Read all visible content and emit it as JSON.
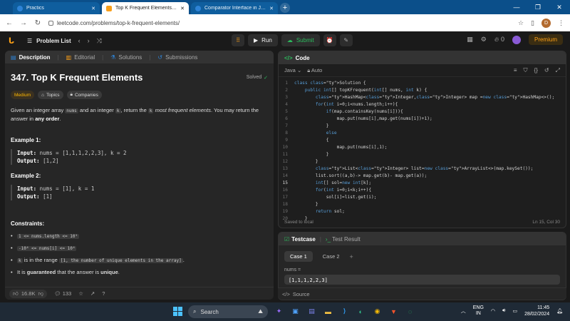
{
  "browser": {
    "tabs": [
      {
        "title": "Practics",
        "active": false
      },
      {
        "title": "Top K Frequent Elements - LeetCode",
        "active": true
      },
      {
        "title": "Comparator Interface in Java with Examples",
        "active": false
      }
    ],
    "url": "leetcode.com/problems/top-k-frequent-elements/",
    "profile_initial": "D"
  },
  "header": {
    "problem_list": "Problem List",
    "run": "Run",
    "submit": "Submit",
    "streak": "0",
    "premium": "Premium"
  },
  "left_tabs": {
    "description": "Description",
    "editorial": "Editorial",
    "solutions": "Solutions",
    "submissions": "Submissions"
  },
  "problem": {
    "title": "347. Top K Frequent Elements",
    "status": "Solved",
    "difficulty": "Medium",
    "topics": "Topics",
    "companies": "Companies",
    "desc_1": "Given an integer array ",
    "desc_code_1": "nums",
    "desc_2": " and an integer ",
    "desc_code_2": "k",
    "desc_3": ", return the ",
    "desc_code_3": "k",
    "desc_em": " most frequent elements",
    "desc_4": ". You may return the answer in ",
    "desc_bold": "any order",
    "desc_5": ".",
    "example1_title": "Example 1:",
    "example1_input_label": "Input:",
    "example1_input": " nums = [1,1,1,2,2,3], k = 2",
    "example1_output_label": "Output:",
    "example1_output": " [1,2]",
    "example2_title": "Example 2:",
    "example2_input_label": "Input:",
    "example2_input": " nums = [1], k = 1",
    "example2_output_label": "Output:",
    "example2_output": " [1]",
    "constraints_title": "Constraints:",
    "c1": "1 <= nums.length <= 10⁵",
    "c2": "-10⁴ <= nums[i] <= 10⁴",
    "c3_code": "k",
    "c3_text": " is in the range ",
    "c3_range": "[1, the number of unique elements in the array]",
    "c3_end": ".",
    "c4_a": "It is ",
    "c4_b": "guaranteed",
    "c4_c": " that the answer is ",
    "c4_d": "unique",
    "c4_e": "."
  },
  "footer": {
    "likes": "16.8K",
    "comments": "133"
  },
  "code": {
    "title": "Code",
    "language": "Java",
    "mode": "Auto",
    "saved": "Saved to local",
    "position": "Ln 15, Col 30",
    "lines": [
      "class Solution {",
      "    public int[] topKFrequent(int[] nums, int k) {",
      "        HashMap<Integer,Integer> map =new HashMap<>();",
      "        for(int i=0;i<nums.length;i++){",
      "            if(map.containsKey(nums[i])){",
      "                map.put(nums[i],map.get(nums[i])+1);",
      "            }",
      "            else",
      "            {",
      "                map.put(nums[i],1);",
      "            }",
      "        }",
      "        List<Integer> list=new ArrayList<>(map.keySet());",
      "        list.sort((a,b)-> map.get(b)- map.get(a));",
      "        int[] sol=new int[k];",
      "        for(int i=0;i<k;i++){",
      "            sol[i]=list.get(i);",
      "        }",
      "        return sol;",
      "    }"
    ],
    "current_line": 15
  },
  "testcase": {
    "tab_testcase": "Testcase",
    "tab_result": "Test Result",
    "case1": "Case 1",
    "case2": "Case 2",
    "input_label": "nums =",
    "input_value": "[1,1,1,2,2,3]",
    "source": "Source"
  },
  "taskbar": {
    "search": "Search",
    "lang_1": "ENG",
    "lang_2": "IN",
    "time": "11:45",
    "date": "28/02/2024"
  }
}
